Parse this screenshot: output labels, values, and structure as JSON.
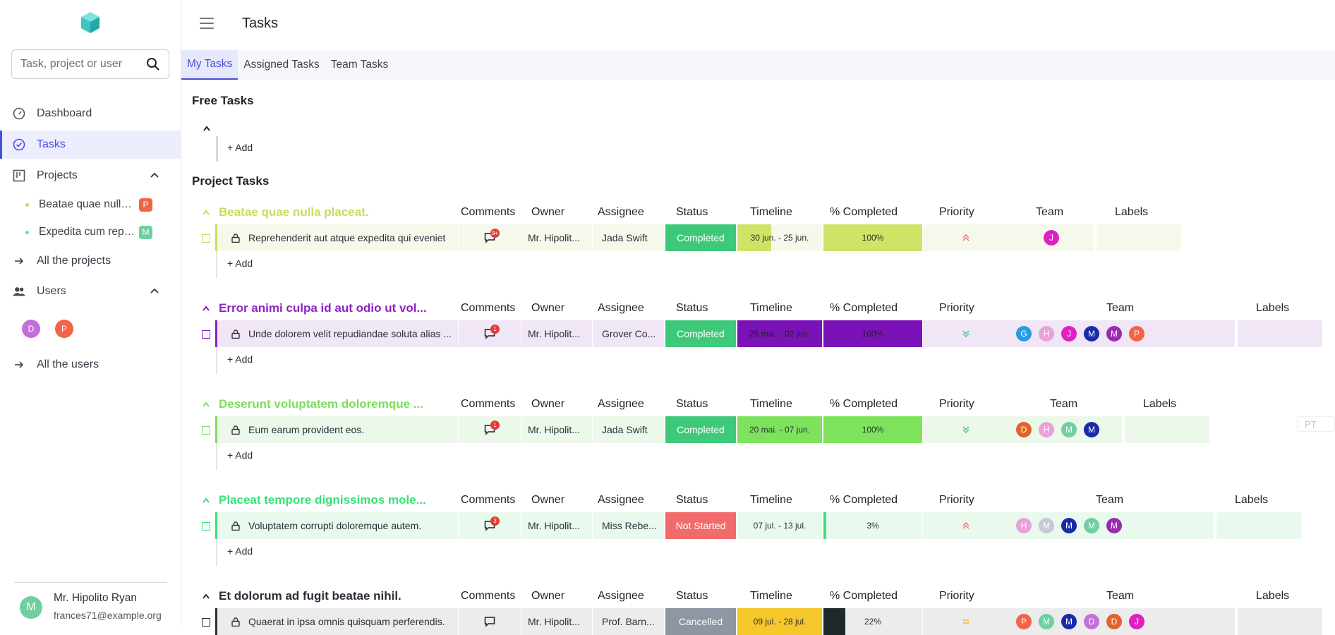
{
  "search": {
    "placeholder": "Task, project or user"
  },
  "nav": {
    "dashboard": "Dashboard",
    "tasks": "Tasks",
    "projects": "Projects",
    "all_projects": "All the projects",
    "users": "Users",
    "all_users": "All the users"
  },
  "projects": [
    {
      "name": "Beatae quae nulla placeat.",
      "dot": "#c4de5e",
      "badge": "P",
      "badge_color": "#f06448"
    },
    {
      "name": "Expedita cum repudiandae",
      "dot": "#5fd7ea",
      "badge": "M",
      "badge_color": "#6fcfa0"
    }
  ],
  "users": [
    {
      "initial": "D",
      "color": "#c36fd8"
    },
    {
      "initial": "P",
      "color": "#f06448"
    }
  ],
  "profile": {
    "initial": "M",
    "name": "Mr. Hipolito Ryan",
    "email": "frances71@example.org",
    "avatar_color": "#6fcfa0"
  },
  "page": {
    "title": "Tasks"
  },
  "tabs": [
    {
      "label": "My Tasks"
    },
    {
      "label": "Assigned Tasks"
    },
    {
      "label": "Team Tasks"
    }
  ],
  "sections": {
    "free": "Free Tasks",
    "project": "Project Tasks"
  },
  "add_label": "+ Add",
  "columns": {
    "comments": "Comments",
    "owner": "Owner",
    "assignee": "Assignee",
    "status": "Status",
    "timeline": "Timeline",
    "completed": "% Completed",
    "priority": "Priority",
    "team": "Team",
    "labels": "Labels"
  },
  "groups": [
    {
      "title": "Beatae quae nulla placeat.",
      "color": "#c4de5e",
      "row_bg": "#f6f8ec",
      "task": "Reprehenderit aut atque expedita qui eveniet",
      "comments": "9+",
      "owner": "Mr. Hipolit...",
      "assignee": "Jada Swift",
      "status": "Completed",
      "status_color": "#3ec97a",
      "timeline": "30 jun. - 25 jun.",
      "timeline_color": "#cfe466",
      "completed": "100%",
      "completed_fraction": 1.0,
      "completed_color": "#cfe466",
      "priority": "high",
      "team": [
        {
          "i": "J",
          "c": "#e020c0"
        }
      ]
    },
    {
      "title": "Error animi culpa id aut odio ut vol...",
      "color": "#8b22c7",
      "row_bg": "#f1e6f6",
      "task": "Unde dolorem velit repudiandae soluta alias ...",
      "comments": "1",
      "owner": "Mr. Hipolit...",
      "assignee": "Grover Co...",
      "status": "Completed",
      "status_color": "#3ec97a",
      "timeline": "25 mai. - 02 jun.",
      "timeline_color": "#7a12b8",
      "completed": "100%",
      "completed_fraction": 1.0,
      "completed_color": "#7a12b8",
      "priority": "low",
      "team": [
        {
          "i": "G",
          "c": "#2a9ae0"
        },
        {
          "i": "H",
          "c": "#e8a2d8"
        },
        {
          "i": "J",
          "c": "#e020c0"
        },
        {
          "i": "M",
          "c": "#1a2aa8"
        },
        {
          "i": "M",
          "c": "#9a2ab0"
        },
        {
          "i": "P",
          "c": "#f06448"
        }
      ]
    },
    {
      "title": "Deserunt voluptatem doloremque ...",
      "color": "#7cdc5c",
      "row_bg": "#ecf8ea",
      "task": "Eum earum provident eos.",
      "comments": "1",
      "owner": "Mr. Hipolit...",
      "assignee": "Jada Swift",
      "status": "Completed",
      "status_color": "#3ec97a",
      "timeline": "20 mai. - 07 jun.",
      "timeline_color": "#7ee35c",
      "completed": "100%",
      "completed_fraction": 1.0,
      "completed_color": "#7ee35c",
      "priority": "low",
      "team": [
        {
          "i": "D",
          "c": "#e06428"
        },
        {
          "i": "H",
          "c": "#e8a2d8"
        },
        {
          "i": "M",
          "c": "#6fcfa0"
        },
        {
          "i": "M",
          "c": "#1a2aa8"
        }
      ]
    },
    {
      "title": "Placeat tempore dignissimos mole...",
      "color": "#38e07a",
      "row_bg": "#e9f9ee",
      "task": "Voluptatem corrupti doloremque autem.",
      "comments": "3",
      "owner": "Mr. Hipolit...",
      "assignee": "Miss Rebe...",
      "status": "Not Started",
      "status_color": "#f26b6b",
      "timeline": "07 jul. - 13 jul.",
      "timeline_color": "#e9f9ee",
      "completed": "3%",
      "completed_fraction": 0.03,
      "completed_color": "#38e07a",
      "priority": "high",
      "team": [
        {
          "i": "H",
          "c": "#e8a2d8"
        },
        {
          "i": "M",
          "c": "#c8c8d8"
        },
        {
          "i": "M",
          "c": "#1a2aa8"
        },
        {
          "i": "M",
          "c": "#6fcfa0"
        },
        {
          "i": "M",
          "c": "#9a2ab0"
        }
      ]
    },
    {
      "title": "Et dolorum ad fugit beatae nihil.",
      "color": "#2b2f38",
      "row_bg": "#ececec",
      "task": "Quaerat in ipsa omnis quisquam perferendis.",
      "comments": "",
      "owner": "Mr. Hipolit...",
      "assignee": "Prof. Barn...",
      "status": "Cancelled",
      "status_color": "#8d96a3",
      "timeline": "09 jul. - 28 jul.",
      "timeline_color": "#f7c82c",
      "completed": "22%",
      "completed_fraction": 0.22,
      "completed_color": "#1e2a2a",
      "priority": "medium",
      "team": [
        {
          "i": "P",
          "c": "#f06448"
        },
        {
          "i": "M",
          "c": "#6fcfa0"
        },
        {
          "i": "M",
          "c": "#1a2aa8"
        },
        {
          "i": "D",
          "c": "#c36fd8"
        },
        {
          "i": "D",
          "c": "#e06428"
        },
        {
          "i": "J",
          "c": "#e020c0"
        }
      ]
    }
  ],
  "language_badge": "PT"
}
